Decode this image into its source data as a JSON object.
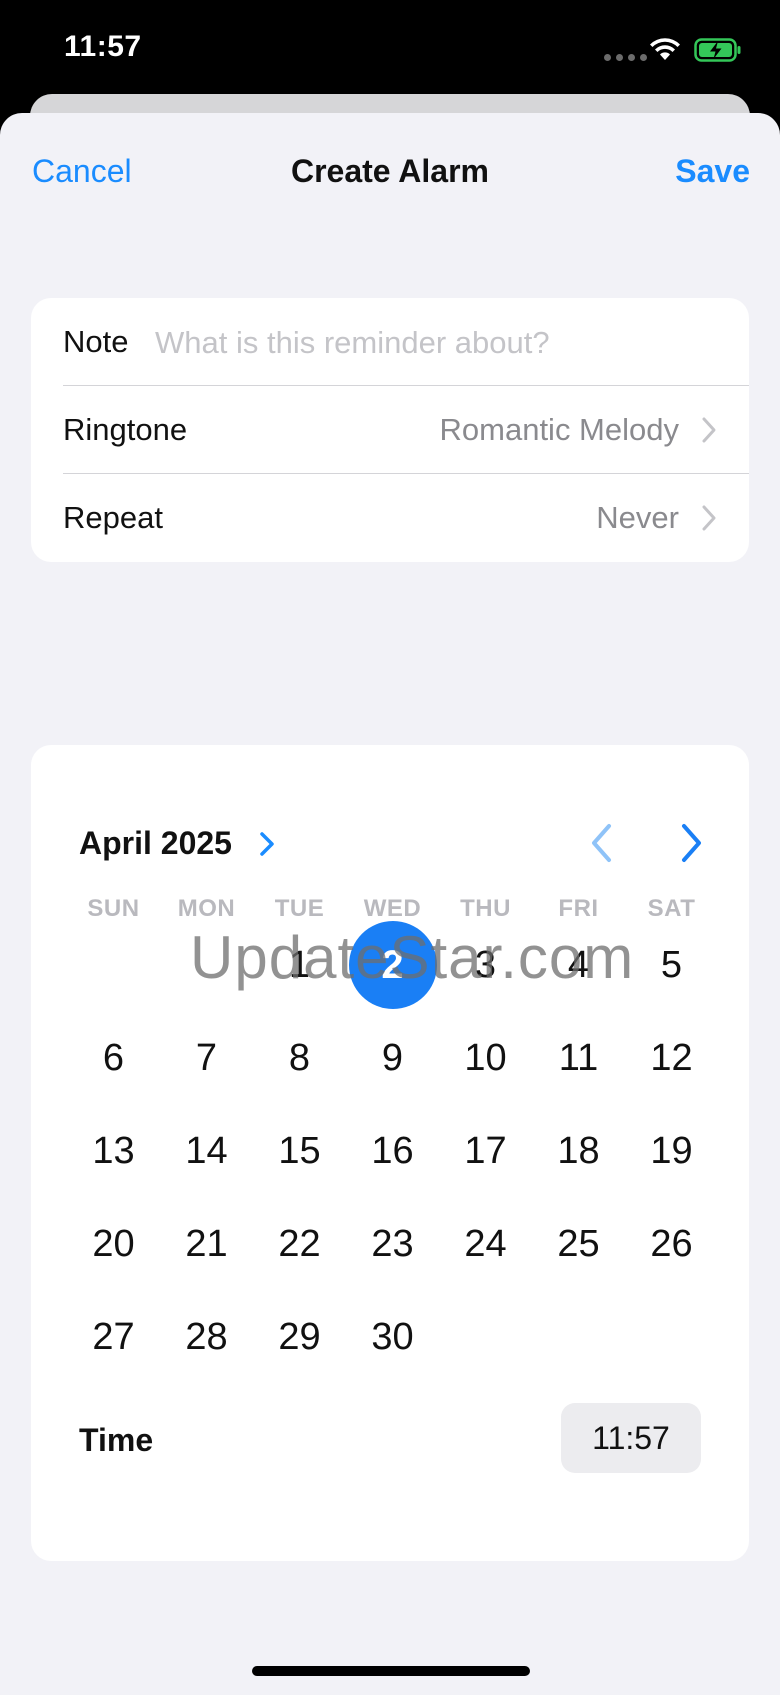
{
  "status_bar": {
    "time": "11:57"
  },
  "header": {
    "cancel_label": "Cancel",
    "title": "Create Alarm",
    "save_label": "Save"
  },
  "settings": {
    "note": {
      "label": "Note",
      "value": "",
      "placeholder": "What is this reminder about?"
    },
    "ringtone": {
      "label": "Ringtone",
      "value": "Romantic Melody"
    },
    "repeat": {
      "label": "Repeat",
      "value": "Never"
    }
  },
  "calendar": {
    "month_label": "April 2025",
    "weekdays": [
      "SUN",
      "MON",
      "TUE",
      "WED",
      "THU",
      "FRI",
      "SAT"
    ],
    "first_weekday_index": 2,
    "selected_day": 2,
    "days": [
      "1",
      "2",
      "3",
      "4",
      "5",
      "6",
      "7",
      "8",
      "9",
      "10",
      "11",
      "12",
      "13",
      "14",
      "15",
      "16",
      "17",
      "18",
      "19",
      "20",
      "21",
      "22",
      "23",
      "24",
      "25",
      "26",
      "27",
      "28",
      "29",
      "30"
    ]
  },
  "time": {
    "label": "Time",
    "value": "11:57"
  },
  "watermark": "UpdateStar.com",
  "colors": {
    "accent": "#1a8cff",
    "selected": "#1a7ff5",
    "sheet_bg": "#f2f2f7"
  },
  "icons": {
    "month_expand": "chevron-right-icon",
    "prev": "chevron-left-icon",
    "next": "chevron-right-icon"
  }
}
